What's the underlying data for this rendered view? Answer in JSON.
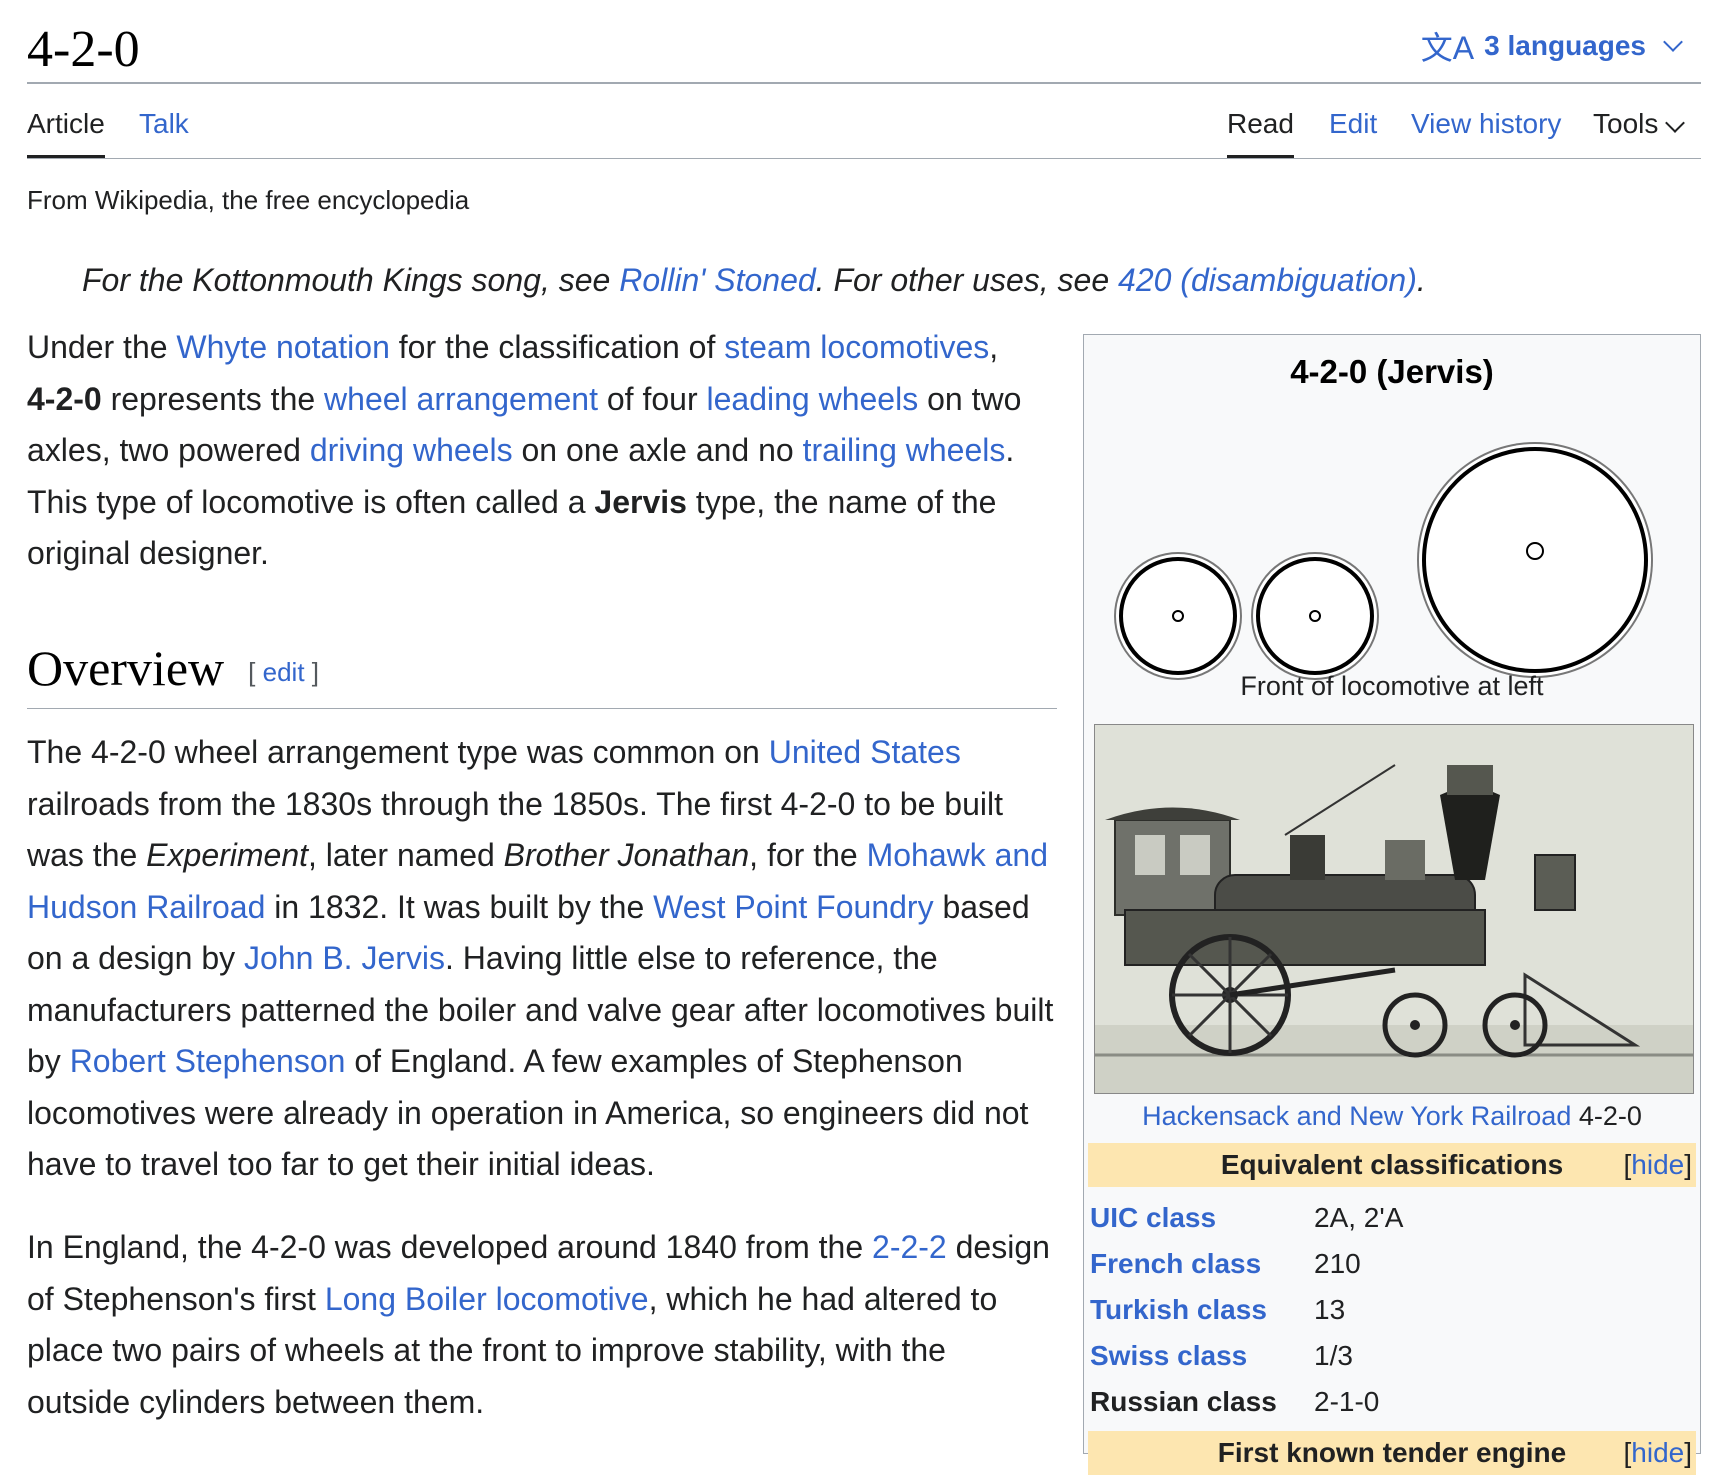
{
  "page": {
    "title": "4-2-0",
    "languages_label": "3 languages",
    "tagline": "From Wikipedia, the free encyclopedia"
  },
  "tabs": {
    "article": "Article",
    "talk": "Talk",
    "read": "Read",
    "edit": "Edit",
    "view_history": "View history",
    "tools": "Tools"
  },
  "hatnote": {
    "part1": "For the Kottonmouth Kings song, see ",
    "link1": "Rollin' Stoned",
    "part2": ". For other uses, see ",
    "link2": "420 (disambiguation)",
    "part3": "."
  },
  "intro": {
    "t1": "Under the ",
    "l1": "Whyte notation",
    "t2": " for the classification of ",
    "l2": "steam locomotives",
    "t3": ",",
    "b1": "4-2-0",
    "t4": " represents the ",
    "l3": "wheel arrangement",
    "t5": " of four ",
    "l4": "leading wheels",
    "t6": " on two axles, two powered ",
    "l5": "driving wheels",
    "t7": " on one axle and no ",
    "l6": "trailing wheels",
    "t8": ". This type of locomotive is often called a ",
    "b2": "Jervis",
    "t9": " type, the name of the original designer."
  },
  "overview": {
    "heading": "Overview",
    "edit_bracket_open": "[",
    "edit_label": "edit",
    "edit_bracket_close": "]",
    "p1": {
      "t1": "The 4-2-0 wheel arrangement type was common on ",
      "l1": "United States",
      "t2": " railroads from the 1830s through the 1850s. The first 4-2-0 to be built was the ",
      "i1": "Experiment",
      "t3": ", later named ",
      "i2": "Brother Jonathan",
      "t4": ", for the ",
      "l2": "Mohawk and Hudson Railroad",
      "t5": " in 1832. It was built by the ",
      "l3": "West Point Foundry",
      "t6": " based on a design by ",
      "l4": "John B. Jervis",
      "t7": ". Having little else to reference, the manufacturers patterned the boiler and valve gear after locomotives built by ",
      "l5": "Robert Stephenson",
      "t8": " of England. A few examples of Stephenson locomotives were already in operation in America, so engineers did not have to travel too far to get their initial ideas."
    },
    "p2": {
      "t1": "In England, the 4-2-0 was developed around 1840 from the ",
      "l1": "2-2-2",
      "t2": " design of Stephenson's first ",
      "l2": "Long Boiler locomotive",
      "t3": ", which he had altered to place two pairs of wheels at the front to improve stability, with the outside cylinders between them."
    }
  },
  "infobox": {
    "title": "4-2-0 (Jervis)",
    "diagram_caption": "Front of locomotive at left",
    "photo_caption_link": "Hackensack and New York Railroad",
    "photo_caption_text": " 4-2-0",
    "equiv_header": "Equivalent classifications",
    "hide_open": "[",
    "hide_label": "hide",
    "hide_close": "]",
    "rows": [
      {
        "label": "UIC class",
        "value": "2A, 2'A"
      },
      {
        "label": "French class",
        "value": "210"
      },
      {
        "label": "Turkish class",
        "value": "13"
      },
      {
        "label": "Swiss class",
        "value": "1/3"
      },
      {
        "label": "Russian class",
        "value": "2-1-0"
      }
    ],
    "next_header": "First known tender engine",
    "colors": {
      "header_bg": "#fde6b0",
      "link": "#3366cc"
    }
  }
}
